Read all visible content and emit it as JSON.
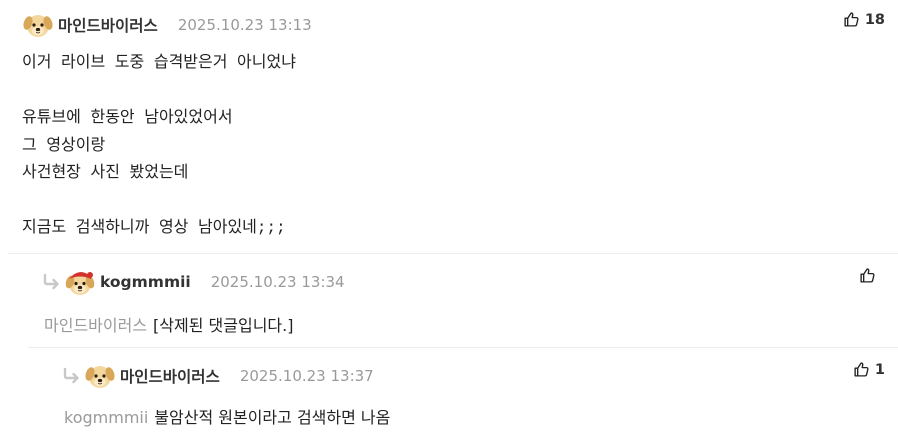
{
  "comments": [
    {
      "nickname": "마인드바이러스",
      "date": "2025.10.23 13:13",
      "likes": "18",
      "avatar_icon": "puppy-avatar-icon",
      "body": "이거 라이브 도중 습격받은거 아니었냐\n\n유튜브에 한동안 남아있었어서\n그 영상이랑\n사건현장 사진 봤었는데\n\n지금도 검색하니까 영상 남아있네;;;"
    },
    {
      "nickname": "kogmmmii",
      "date": "2025.10.23 13:34",
      "likes": "",
      "avatar_icon": "red-hat-puppy-avatar-icon",
      "mention": "마인드바이러스",
      "body": "[삭제된 댓글입니다.]"
    },
    {
      "nickname": "마인드바이러스",
      "date": "2025.10.23 13:37",
      "likes": "1",
      "avatar_icon": "puppy-avatar-icon",
      "mention": "kogmmmii",
      "body": "불암산적 원본이라고 검색하면 나옴"
    }
  ],
  "colors": {
    "text": "#222222",
    "muted": "#9a9a9a",
    "divider": "#ececec",
    "reply_arrow": "#c8c8c8"
  },
  "icons": {
    "like": "thumbs-up-icon",
    "reply": "reply-arrow-icon"
  }
}
